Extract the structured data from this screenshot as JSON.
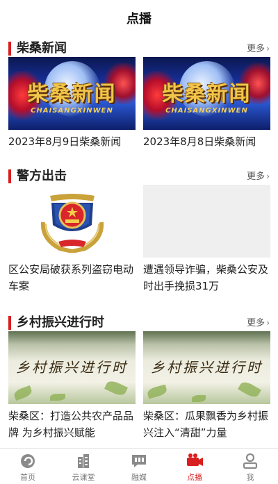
{
  "header": {
    "title": "点播"
  },
  "sections": [
    {
      "title": "柴桑新闻",
      "more": "更多",
      "items": [
        {
          "caption": "2023年8月9日柴桑新闻",
          "thumb_text": "柴桑新闻",
          "thumb_subtext": "CHAISANGXINWEN"
        },
        {
          "caption": "2023年8月8日柴桑新闻",
          "thumb_text": "柴桑新闻",
          "thumb_subtext": "CHAISANGXINWEN"
        }
      ]
    },
    {
      "title": "警方出击",
      "more": "更多",
      "items": [
        {
          "caption": "区公安局破获系列盗窃电动车案"
        },
        {
          "caption": "遭遇领导诈骗，柴桑公安及时出手挽损31万"
        }
      ]
    },
    {
      "title": "乡村振兴进行时",
      "more": "更多",
      "items": [
        {
          "caption": "柴桑区：打造公共农产品品牌 为乡村振兴赋能",
          "thumb_text": "乡村振兴进行时"
        },
        {
          "caption": "柴桑区：瓜果飘香为乡村振兴注入“清甜”力量",
          "thumb_text": "乡村振兴进行时"
        }
      ]
    }
  ],
  "tabbar": {
    "items": [
      {
        "label": "首页",
        "icon": "home-icon"
      },
      {
        "label": "云课堂",
        "icon": "building-icon"
      },
      {
        "label": "融媒",
        "icon": "chat-icon"
      },
      {
        "label": "点播",
        "icon": "video-icon",
        "active": true
      },
      {
        "label": "我",
        "icon": "user-icon"
      }
    ]
  },
  "colors": {
    "accent": "#d81e1e",
    "muted": "#777777"
  }
}
